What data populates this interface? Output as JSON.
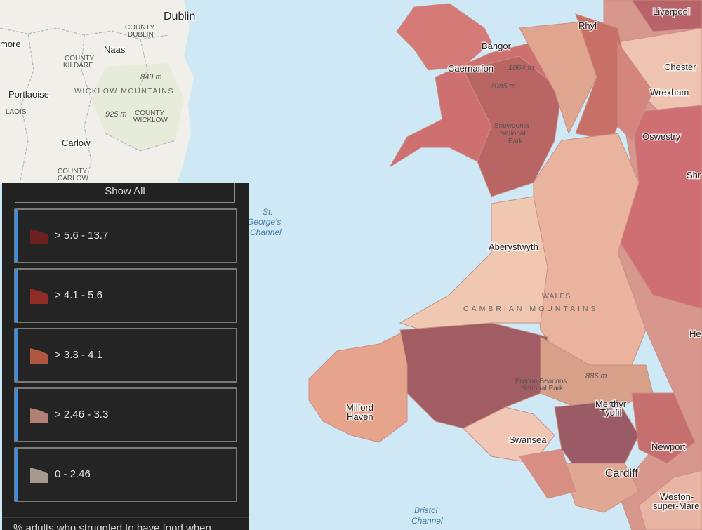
{
  "map": {
    "colors": {
      "sea": "#cfe8f5",
      "ireland_land": "#f1efe9",
      "class_1": "#6b1f1f",
      "class_2": "#8e2c25",
      "class_3": "#b0573f",
      "class_4": "#b08074",
      "class_5": "#a8998f"
    },
    "labels": {
      "dublin": "Dublin",
      "county_dublin": "COUNTY\nDUBLIN",
      "naas": "Naas",
      "more": "more",
      "county_kildare": "COUNTY\nKILDARE",
      "elev_849": "849 m",
      "wicklow_mountains": "WICKLOW MOUNTAINS",
      "portlaoise": "Portlaoise",
      "laois": "LAOIS",
      "elev_925": "925 m",
      "county_wicklow": "COUNTY\nWICKLOW",
      "carlow": "Carlow",
      "county_carlow": "COUNTY\nCARLOW",
      "st_georges_channel": "St.\nGeorge's\nChannel",
      "bristol_channel": "Bristol\nChannel",
      "rhyl": "Rhyl",
      "liverpool": "Liverpool",
      "bangor": "Bangor",
      "caernarfon": "Caernarfon",
      "elev_1064": "1064 m",
      "elev_1085": "1085 m",
      "chester": "Chester",
      "wrexham": "Wrexham",
      "snowdonia": "Snowdonia\nNational\nPark",
      "oswestry": "Oswestry",
      "shr": "Shr",
      "aberystwyth": "Aberystwyth",
      "wales": "WALES",
      "cambrian_mountains": "CAMBRIAN MOUNTAINS",
      "he": "He",
      "elev_886": "886 m",
      "brecon": "Brecon Beacons\nNational Park",
      "milford_haven": "Milford\nHaven",
      "merthyr": "Merthyr\nTydfil",
      "swansea": "Swansea",
      "newport": "Newport",
      "cardiff": "Cardiff",
      "weston": "Weston-\nsuper-Mare"
    }
  },
  "legend": {
    "show_all": "Show All",
    "classes": [
      {
        "label": "> 5.6 - 13.7",
        "color": "#6b1f1f"
      },
      {
        "label": "> 4.1 - 5.6",
        "color": "#8e2c25"
      },
      {
        "label": "> 3.3 - 4.1",
        "color": "#b0573f"
      },
      {
        "label": "> 2.46 - 3.3",
        "color": "#b08074"
      },
      {
        "label": "0 - 2.46",
        "color": "#a8998f"
      }
    ],
    "title_partial": "% adults who struggled to have food when"
  }
}
